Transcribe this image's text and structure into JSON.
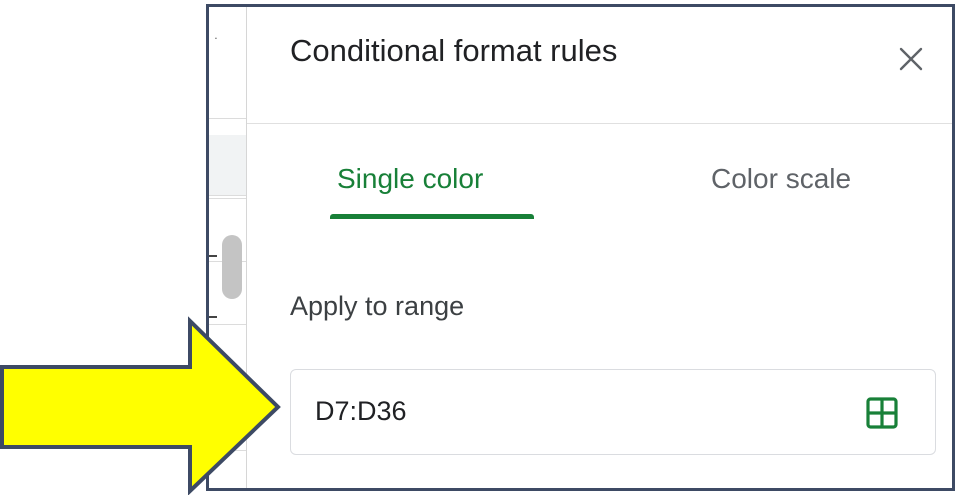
{
  "panel": {
    "title": "Conditional format rules",
    "close_icon": "close-icon"
  },
  "tabs": [
    {
      "label": "Single color",
      "active": true
    },
    {
      "label": "Color scale",
      "active": false
    }
  ],
  "apply_to_range": {
    "label": "Apply to range",
    "value": "D7:D36",
    "icon": "grid-select-icon"
  },
  "annotation": {
    "icon": "arrow-right-icon",
    "fill_color": "#ffff00",
    "stroke_color": "#3d4a64"
  },
  "colors": {
    "accent": "#188038",
    "frame_border": "#3d4a64",
    "text_primary": "#202124",
    "text_secondary": "#5f6368"
  }
}
